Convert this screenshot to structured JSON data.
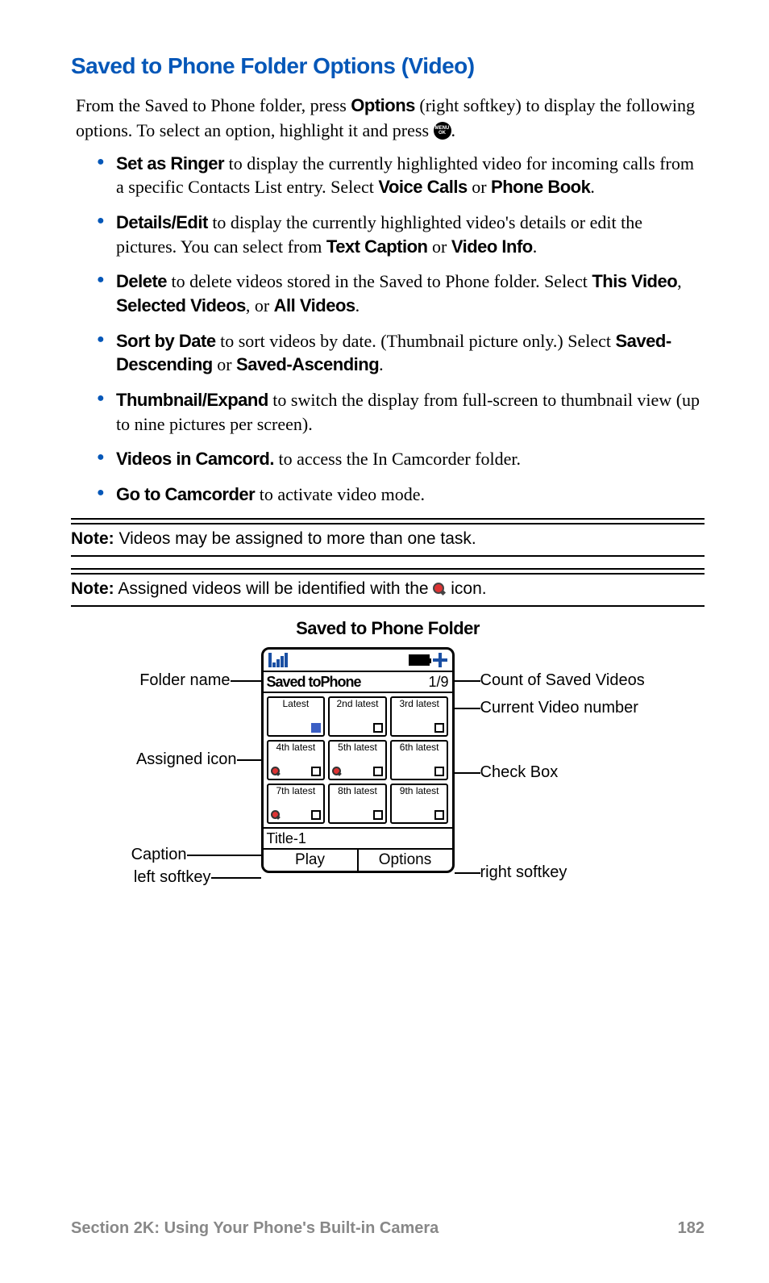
{
  "heading": "Saved to Phone Folder Options (Video)",
  "intro": {
    "pre": "From the Saved to Phone folder, press ",
    "optWord": "Options",
    "mid": " (right softkey) to display the following options.  To select an option, highlight it and press ",
    "btnTop": "MENU",
    "btnBot": "OK",
    "post": "."
  },
  "bullets": [
    {
      "lead": "Set as Ringer",
      "t1": " to display the currently highlighted video for incoming calls from a specific Contacts List entry. Select ",
      "b1": "Voice Calls",
      "t2": " or ",
      "b2": "Phone Book",
      "t3": "."
    },
    {
      "lead": "Details/Edit",
      "t1": " to display the currently highlighted video's details or edit the pictures.  You can select from ",
      "b1": "Text Caption",
      "t2": " or ",
      "b2": "Video Info",
      "t3": "."
    },
    {
      "lead": "Delete",
      "t1": " to delete videos stored in the Saved to Phone folder. Select ",
      "b1": "This Video",
      "t2": ", ",
      "b2": "Selected Videos",
      "t3": ", or ",
      "b3": "All Videos",
      "t4": "."
    },
    {
      "lead": "Sort by Date",
      "t1": " to sort videos by date. (Thumbnail picture only.) Select ",
      "b1": "Saved-Descending",
      "t2": " or ",
      "b2": "Saved-Ascending",
      "t3": "."
    },
    {
      "lead": "Thumbnail/Expand",
      "t1": " to switch the display from full-screen to thumbnail view (up to nine pictures per screen)."
    },
    {
      "lead": "Videos in Camcord.",
      "t1": " to access the In Camcorder folder."
    },
    {
      "lead": "Go to Camcorder",
      "t1": " to activate video mode."
    }
  ],
  "notes": {
    "label": "Note:",
    "n1": " Videos may be assigned to more than one task.",
    "n2pre": " Assigned videos will be identified with the ",
    "n2post": " icon."
  },
  "diagram": {
    "title": "Saved to Phone Folder",
    "left": {
      "folderName": "Folder name",
      "assignedIcon": "Assigned icon",
      "caption": "Caption",
      "leftSoftkey": "left softkey"
    },
    "right": {
      "countSaved": "Count of Saved Videos",
      "currentNum": "Current Video number",
      "checkBox": "Check Box",
      "rightSoftkey": "right softkey"
    },
    "phone": {
      "folderName": "Saved toPhone",
      "counter": "1/9",
      "thumbs": [
        "Latest",
        "2nd latest",
        "3rd latest",
        "4th latest",
        "5th latest",
        "6th latest",
        "7th latest",
        "8th latest",
        "9th latest"
      ],
      "caption": "Title-1",
      "leftKey": "Play",
      "rightKey": "Options"
    }
  },
  "footer": {
    "section": "Section 2K: Using Your Phone's Built-in Camera",
    "page": "182"
  }
}
